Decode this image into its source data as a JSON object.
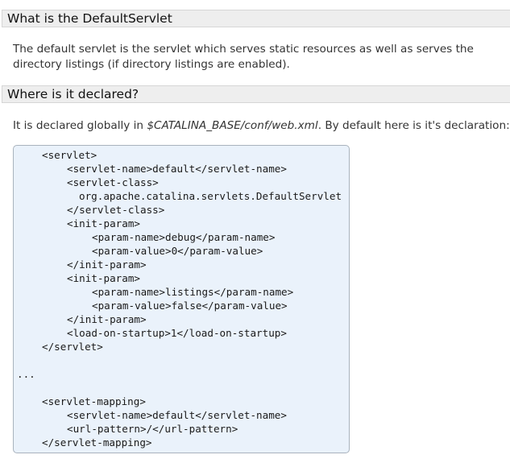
{
  "sections": [
    {
      "heading": "What is the DefaultServlet",
      "paragraph": "The default servlet is the servlet which serves static resources as well as serves the directory listings (if directory listings are enabled)."
    },
    {
      "heading": "Where is it declared?",
      "paragraph_before": "It is declared globally in ",
      "paragraph_path": "$CATALINA_BASE/conf/web.xml",
      "paragraph_after": ". By default here is it's declaration:"
    }
  ],
  "code": {
    "lines": [
      "<servlet>",
      "<servlet-name>default</servlet-name>",
      "<servlet-class>",
      "org.apache.catalina.servlets.DefaultServlet",
      "</servlet-class>",
      "<init-param>",
      "<param-name>debug</param-name>",
      "<param-value>0</param-value>",
      "</init-param>",
      "<init-param>",
      "<param-name>listings</param-name>",
      "<param-value>false</param-value>",
      "</init-param>",
      "<load-on-startup>1</load-on-startup>",
      "</servlet>",
      "",
      "...",
      "",
      "<servlet-mapping>",
      "<servlet-name>default</servlet-name>",
      "<url-pattern>/</url-pattern>",
      "</servlet-mapping>"
    ]
  },
  "colors": {
    "header_bg": "#eeeeee",
    "code_bg": "#eaf2fb",
    "code_border": "#a9b3bd"
  }
}
